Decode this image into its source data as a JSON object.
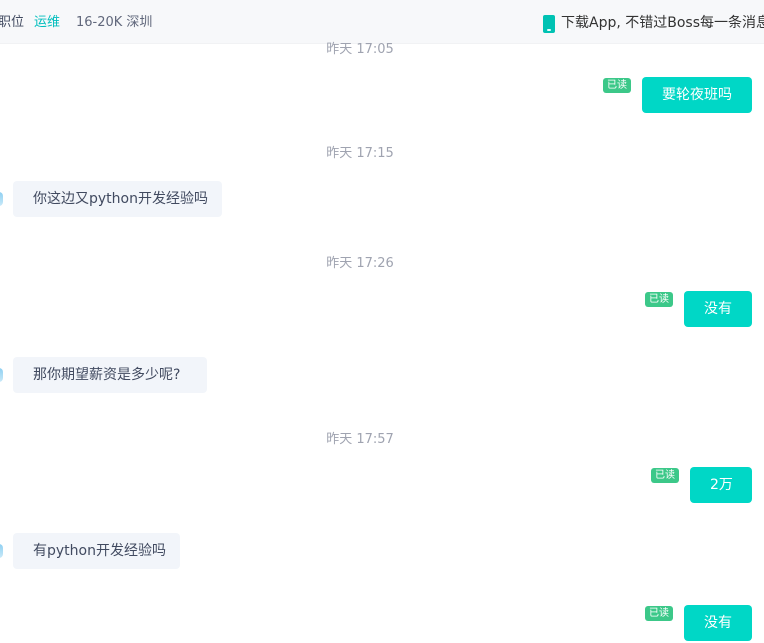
{
  "header": {
    "position_label": "职位",
    "role": "运维",
    "salary_location": "16-20K 深圳",
    "download_text": "下载App, 不错过Boss每一条消息"
  },
  "icons": {
    "phone": "mobile-phone-icon",
    "avatar": "avatar"
  },
  "colors": {
    "accent": "#00d7c6",
    "read_badge": "#3cc889",
    "incoming_bubble": "#f2f5fa"
  },
  "messages": {
    "time1": "昨天 17:05",
    "m1": {
      "text": "要轮夜班吗",
      "status": "已读"
    },
    "time2": "昨天 17:15",
    "m2": {
      "text": "你这边又python开发经验吗"
    },
    "time3": "昨天 17:26",
    "m3": {
      "text": "没有",
      "status": "已读"
    },
    "m4": {
      "text": "那你期望薪资是多少呢?"
    },
    "time4": "昨天 17:57",
    "m5": {
      "text": "2万",
      "status": "已读"
    },
    "m6": {
      "text": "有python开发经验吗"
    },
    "m7": {
      "text": "没有",
      "status": "已读"
    }
  }
}
